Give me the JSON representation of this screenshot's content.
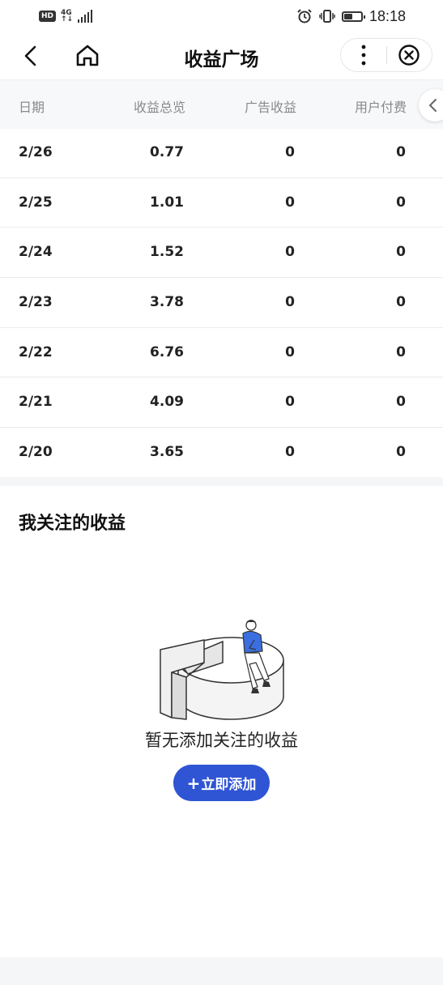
{
  "status_bar": {
    "hd": "HD",
    "network_top": "4G",
    "network_bottom": "↑↓",
    "time": "18:18",
    "battery_level": 0.5
  },
  "nav": {
    "title": "收益广场"
  },
  "table": {
    "headers": [
      "日期",
      "收益总览",
      "广告收益",
      "用户付费"
    ],
    "rows": [
      [
        "2/26",
        "0.77",
        "0",
        "0"
      ],
      [
        "2/25",
        "1.01",
        "0",
        "0"
      ],
      [
        "2/24",
        "1.52",
        "0",
        "0"
      ],
      [
        "2/23",
        "3.78",
        "0",
        "0"
      ],
      [
        "2/22",
        "6.76",
        "0",
        "0"
      ],
      [
        "2/21",
        "4.09",
        "0",
        "0"
      ],
      [
        "2/20",
        "3.65",
        "0",
        "0"
      ]
    ]
  },
  "follow": {
    "title": "我关注的收益",
    "empty_text": "暂无添加关注的收益",
    "add_plus": "+",
    "add_label": "立即添加"
  },
  "colors": {
    "accent": "#2f55d4",
    "illustration_shirt": "#3b6fe0"
  }
}
